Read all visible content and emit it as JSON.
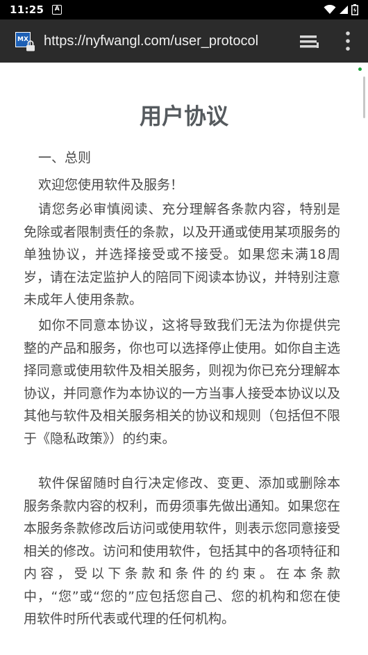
{
  "status_bar": {
    "time": "11:25",
    "notification_icon": "a-box-icon",
    "icons": [
      "wifi-icon",
      "signal-icon",
      "battery-icon"
    ]
  },
  "browser": {
    "url": "https://nyfwangl.com/user_protocol",
    "site_icon_text": "MX",
    "accent_color": "#1c5fb5",
    "toolbar_color": "#2b2b2b"
  },
  "page": {
    "title": "用户协议",
    "paragraphs": [
      "一、总则",
      "欢迎您使用软件及服务！",
      "请您务必审慎阅读、充分理解各条款内容，特别是免除或者限制责任的条款，以及开通或使用某项服务的单独协议，并选择接受或不接受。如果您未满18周岁，请在法定监护人的陪同下阅读本协议，并特别注意未成年人使用条款。",
      "如你不同意本协议，这将导致我们无法为你提供完整的产品和服务，你也可以选择停止使用。如你自主选择同意或使用软件及相关服务，则视为你已充分理解本协议，并同意作为本协议的一方当事人接受本协议以及其他与软件及相关服务相关的协议和规则（包括但不限于《隐私政策》）的约束。",
      "软件保留随时自行决定修改、变更、添加或删除本服务条款内容的权利，而毋须事先做出通知。如果您在本服务条款修改后访问或使用软件，则表示您同意接受相关的修改。访问和使用软件，包括其中的各项特征和内容，受以下条款和条件的约束。在本条款中，“您”或“您的”应包括您自己、您的机构和您在使用软件时所代表或代理的任何机构。"
    ]
  }
}
